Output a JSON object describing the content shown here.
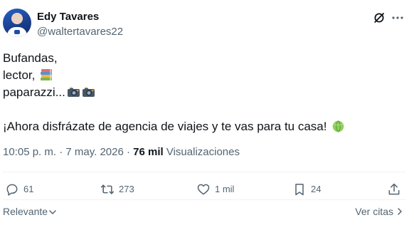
{
  "author": {
    "name": "Edy Tavares",
    "handle": "@waltertavares22"
  },
  "icons": {
    "grok": "grok-icon",
    "more": "more-horizontal-icon",
    "reply": "reply-icon",
    "repost": "repost-icon",
    "like": "heart-icon",
    "bookmark": "bookmark-icon",
    "share": "share-icon",
    "books_emoji": "books-emoji",
    "camera_flash_emoji": "camera-with-flash-emoji",
    "melon_emoji": "melon-emoji"
  },
  "post": {
    "lines": [
      "Bufandas,",
      "lector,",
      "paparazzi...",
      "¡Ahora disfrázate de agencia de viajes y te vas para tu casa!"
    ]
  },
  "meta": {
    "timestamp": "10:05 p. m. · 7 may. 2026 · ",
    "views_count": "76 mil",
    "views_label": " Visualizaciones"
  },
  "actions": {
    "replies": "61",
    "reposts": "273",
    "likes": "1 mil",
    "bookmarks": "24"
  },
  "footer": {
    "sort_label": "Relevante",
    "quotes_label": "Ver citas"
  },
  "colors": {
    "text_primary": "#0f1419",
    "text_secondary": "#536471",
    "divider": "#eff3f4"
  }
}
